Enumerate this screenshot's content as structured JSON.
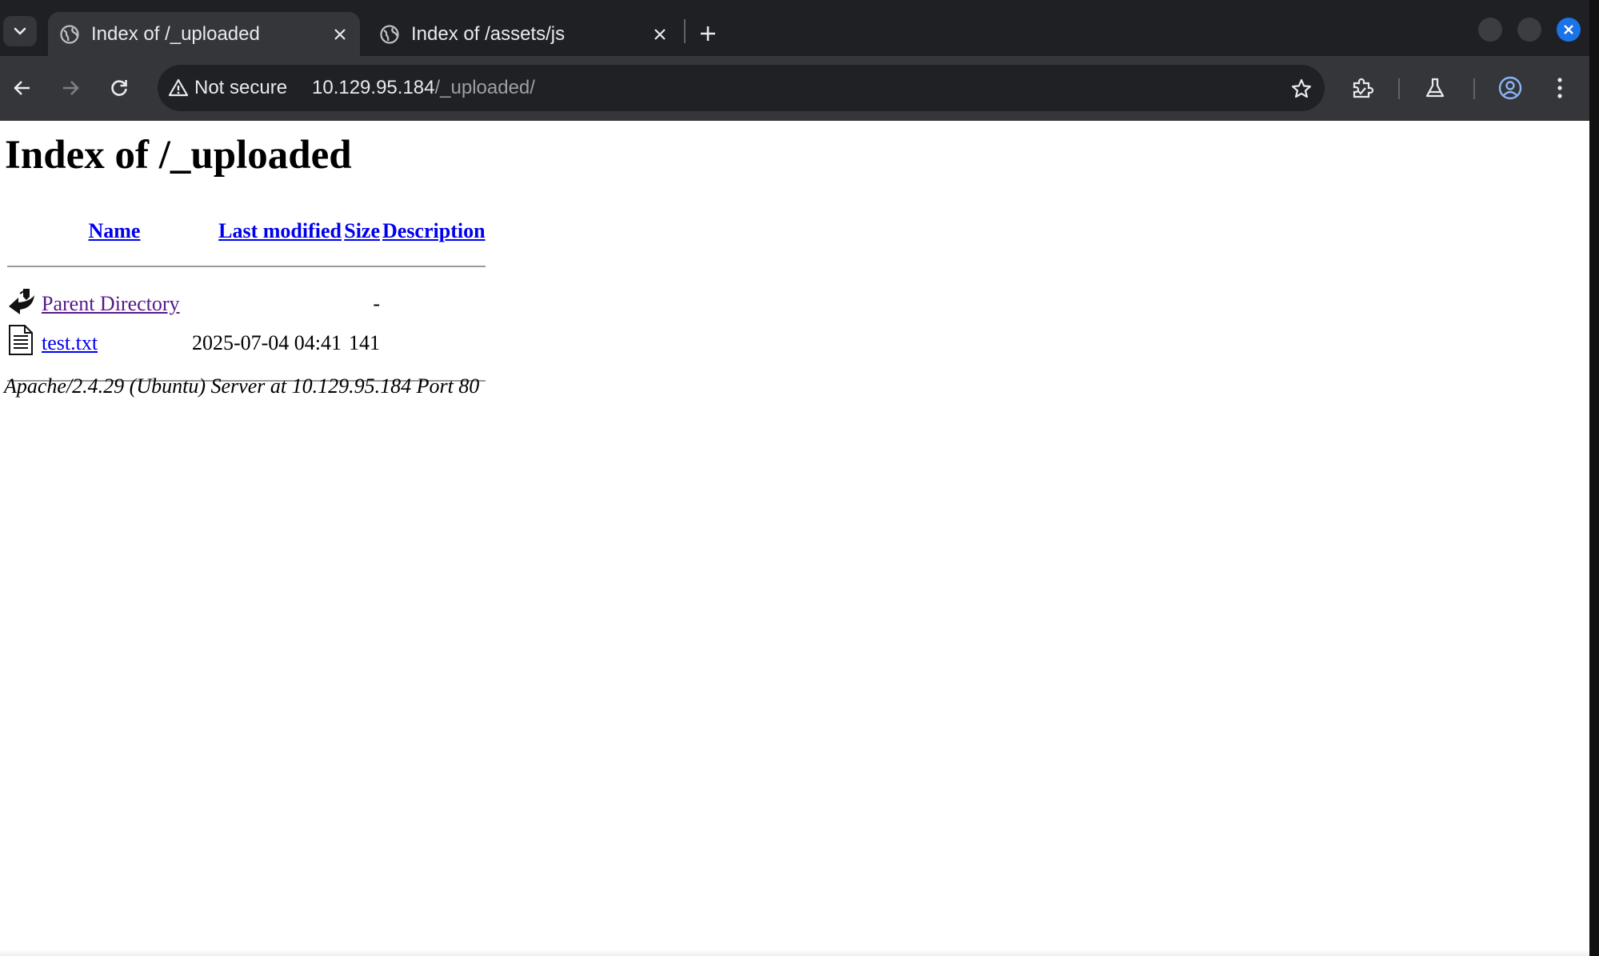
{
  "browser": {
    "tabs": [
      {
        "title": "Index of /_uploaded",
        "active": true
      },
      {
        "title": "Index of /assets/js",
        "active": false
      }
    ],
    "security_label": "Not secure",
    "url_host": "10.129.95.184",
    "url_path": "/_uploaded/",
    "accent_color": "#1a73e8"
  },
  "page": {
    "heading": "Index of /_uploaded",
    "columns": {
      "name": "Name",
      "last_modified": "Last modified",
      "size": "Size",
      "description": "Description"
    },
    "rows": [
      {
        "icon": "back-icon",
        "name": "Parent Directory",
        "modified": "",
        "size": "-",
        "description": ""
      },
      {
        "icon": "text-file-icon",
        "name": "test.txt",
        "modified": "2025-07-04 04:41",
        "size": "141",
        "description": ""
      }
    ],
    "footer": "Apache/2.4.29 (Ubuntu) Server at 10.129.95.184 Port 80"
  }
}
